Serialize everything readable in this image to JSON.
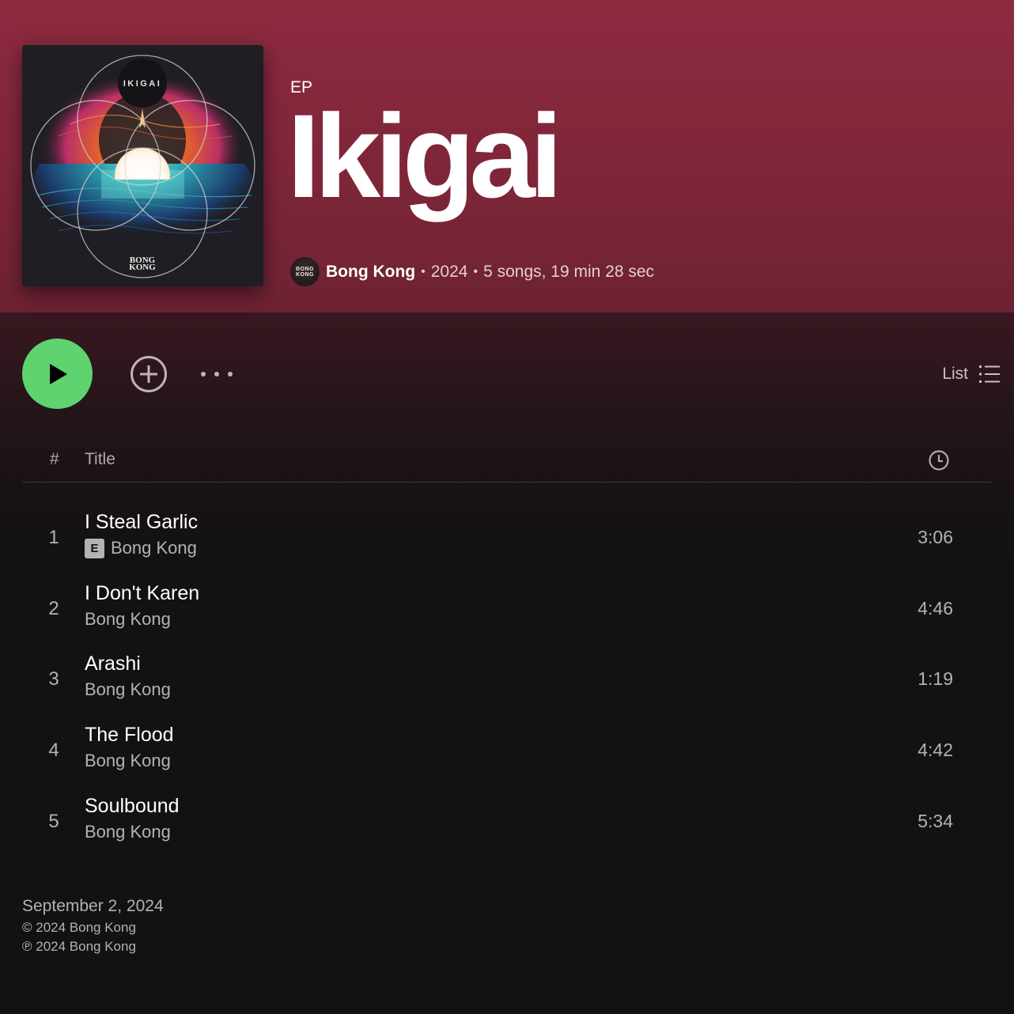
{
  "album": {
    "type": "EP",
    "title": "Ikigai",
    "cover": {
      "top_text": "IKIGAI",
      "logo_line1": "BONG",
      "logo_line2": "KONG"
    },
    "artist": "Bong Kong",
    "artist_avatar_line1": "BONG",
    "artist_avatar_line2": "KONG",
    "year": "2024",
    "summary": "5 songs, 19 min 28 sec",
    "separator": "•"
  },
  "actions": {
    "play_icon": "play-icon",
    "add_icon": "add-circle-icon",
    "more_icon": "more-icon",
    "view_label": "List",
    "view_icon": "list-icon"
  },
  "table_header": {
    "number": "#",
    "title": "Title",
    "duration_icon": "clock-icon"
  },
  "tracks": [
    {
      "number": "1",
      "title": "I Steal Garlic",
      "artist": "Bong Kong",
      "explicit": "E",
      "duration": "3:06"
    },
    {
      "number": "2",
      "title": "I Don't Karen",
      "artist": "Bong Kong",
      "duration": "4:46"
    },
    {
      "number": "3",
      "title": "Arashi",
      "artist": "Bong Kong",
      "duration": "1:19"
    },
    {
      "number": "4",
      "title": "The Flood",
      "artist": "Bong Kong",
      "duration": "4:42"
    },
    {
      "number": "5",
      "title": "Soulbound",
      "artist": "Bong Kong",
      "duration": "5:34"
    }
  ],
  "footer": {
    "release_date": "September 2, 2024",
    "copyright": "© 2024 Bong Kong",
    "phonogram": "℗ 2024 Bong Kong"
  },
  "colors": {
    "header_bg": "#8d2a40",
    "play_button": "#5ed36f",
    "page_bg": "#121212"
  }
}
